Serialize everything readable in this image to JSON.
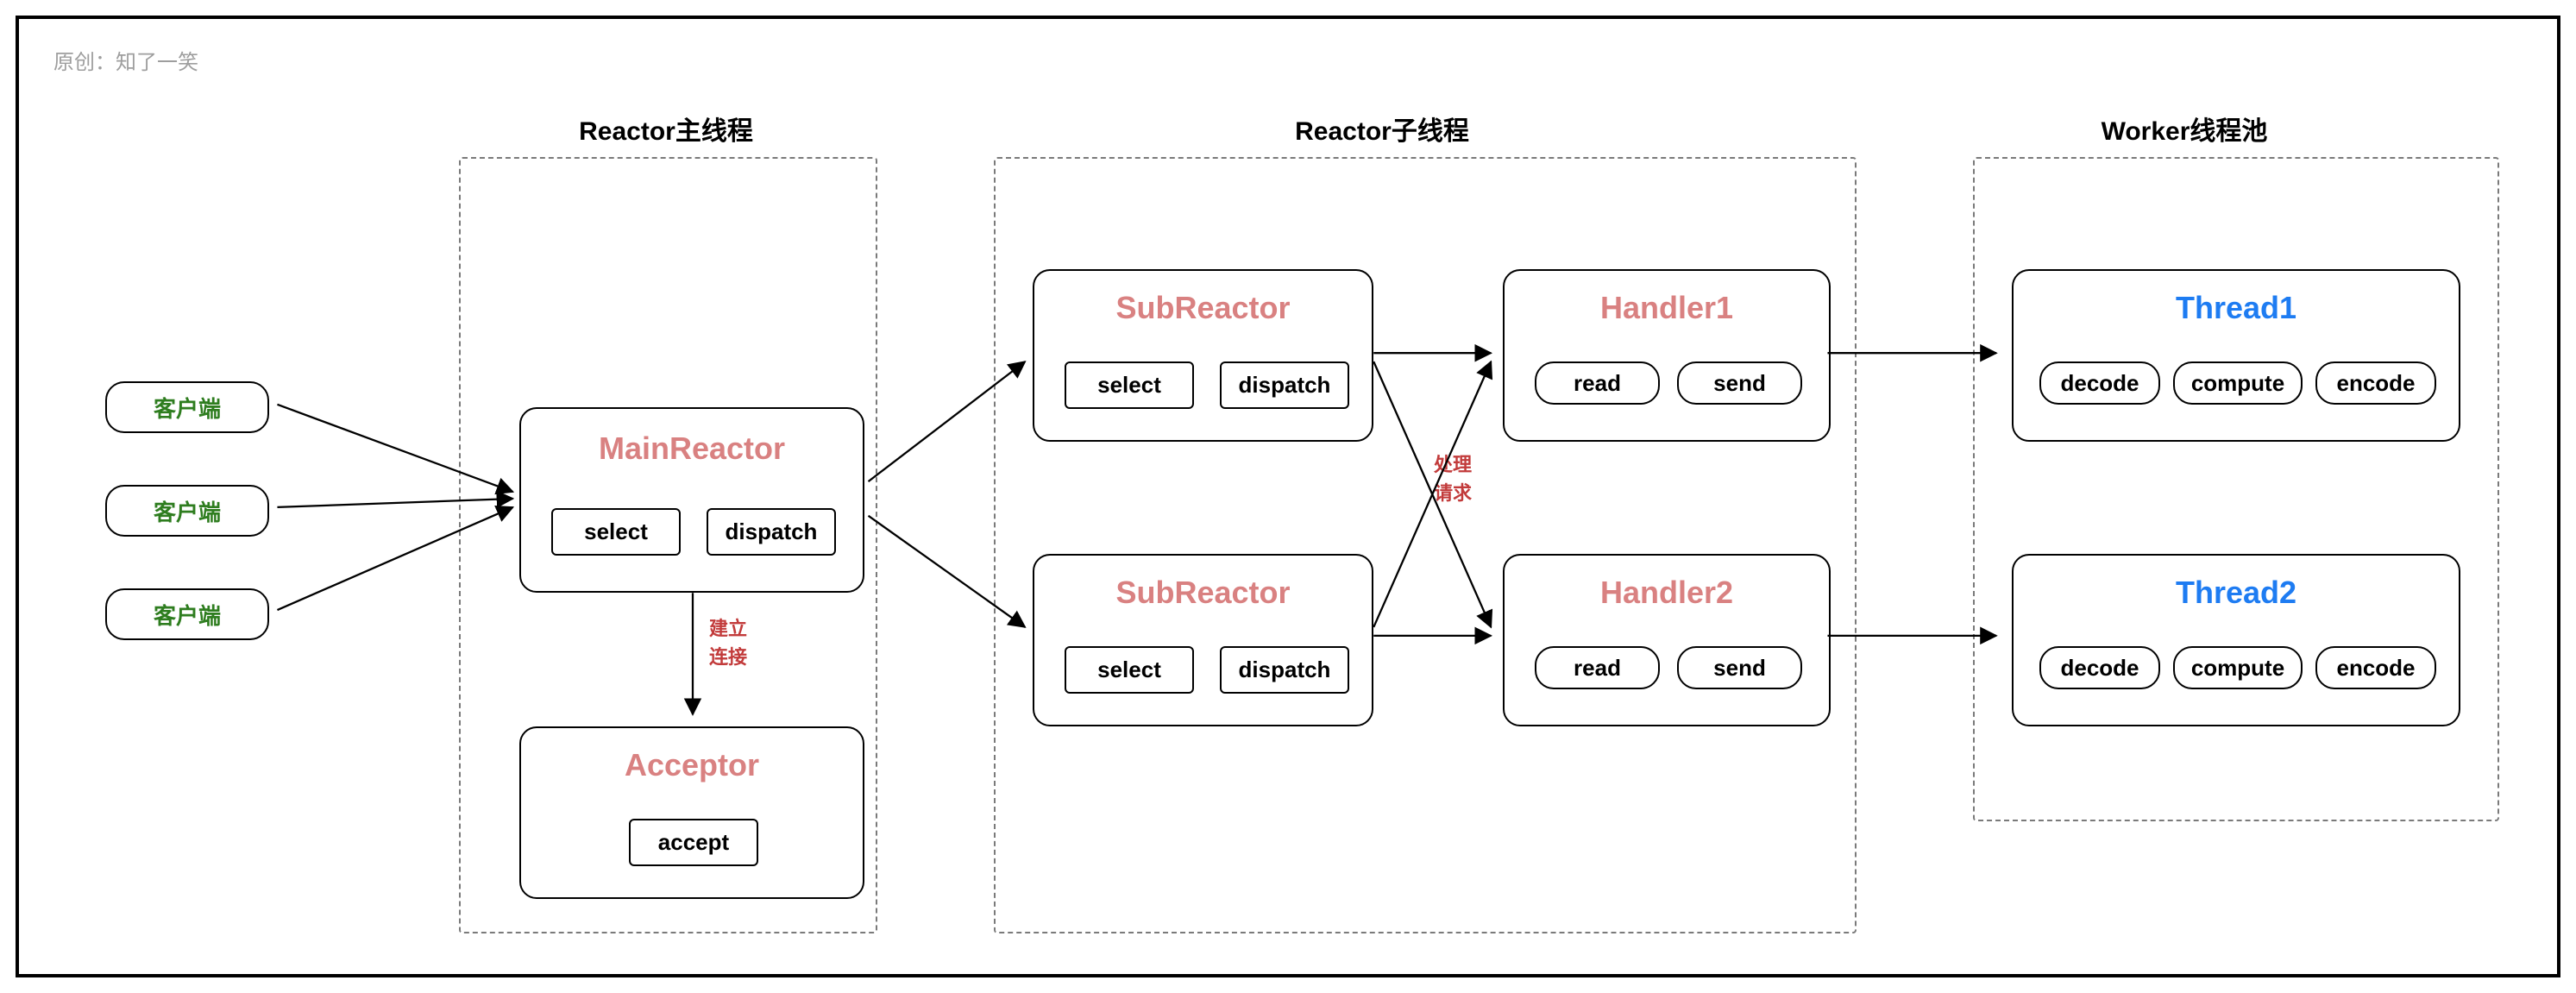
{
  "attribution": "原创：知了一笑",
  "sections": {
    "main": {
      "title": "Reactor主线程"
    },
    "sub": {
      "title": "Reactor子线程"
    },
    "worker": {
      "title": "Worker线程池"
    }
  },
  "clients": {
    "c1": "客户端",
    "c2": "客户端",
    "c3": "客户端"
  },
  "mainReactor": {
    "title": "MainReactor",
    "m1": "select",
    "m2": "dispatch"
  },
  "acceptor": {
    "title": "Acceptor",
    "m1": "accept"
  },
  "subReactor1": {
    "title": "SubReactor",
    "m1": "select",
    "m2": "dispatch"
  },
  "subReactor2": {
    "title": "SubReactor",
    "m1": "select",
    "m2": "dispatch"
  },
  "handler1": {
    "title": "Handler1",
    "m1": "read",
    "m2": "send"
  },
  "handler2": {
    "title": "Handler2",
    "m1": "read",
    "m2": "send"
  },
  "thread1": {
    "title": "Thread1",
    "m1": "decode",
    "m2": "compute",
    "m3": "encode"
  },
  "thread2": {
    "title": "Thread2",
    "m1": "decode",
    "m2": "compute",
    "m3": "encode"
  },
  "edgeLabels": {
    "establish_l1": "建立",
    "establish_l2": "连接",
    "process_l1": "处理",
    "process_l2": "请求"
  }
}
